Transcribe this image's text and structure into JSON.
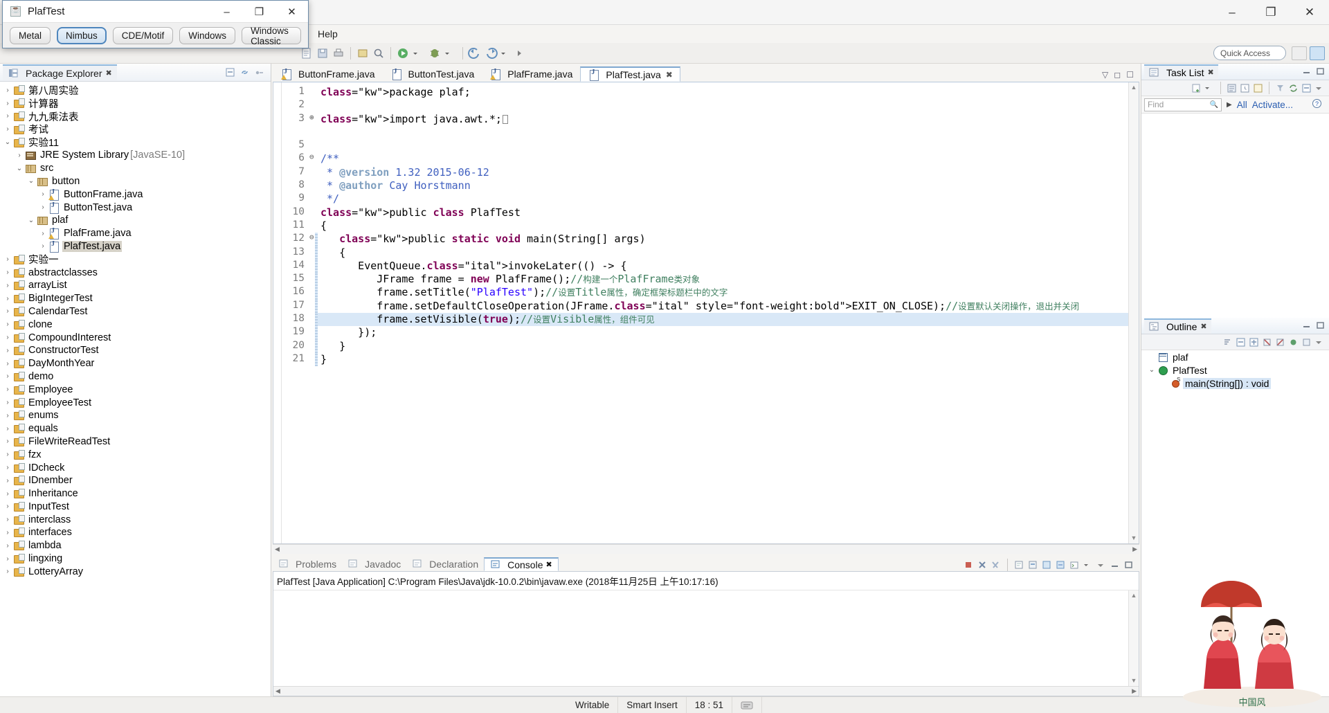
{
  "window": {
    "menu_visible_label": "Help",
    "minimize": "–",
    "maximize": "❐",
    "close": "✕"
  },
  "toolbar": {
    "quick_access_placeholder": "Quick Access"
  },
  "package_explorer": {
    "title": "Package Explorer",
    "close_glyph": "✖",
    "items": [
      {
        "label": "第八周实验",
        "indent": 0,
        "arrow": "›",
        "icon": "project-icon"
      },
      {
        "label": "计算器",
        "indent": 0,
        "arrow": "›",
        "icon": "project-icon"
      },
      {
        "label": "九九乘法表",
        "indent": 0,
        "arrow": "›",
        "icon": "project-icon"
      },
      {
        "label": "考试",
        "indent": 0,
        "arrow": "›",
        "icon": "project-icon"
      },
      {
        "label": "实验11",
        "indent": 0,
        "arrow": "⌄",
        "icon": "project-icon"
      },
      {
        "label": "JRE System Library",
        "suffix": " [JavaSE-10]",
        "indent": 1,
        "arrow": "›",
        "icon": "library-icon"
      },
      {
        "label": "src",
        "indent": 1,
        "arrow": "⌄",
        "icon": "source-folder-icon"
      },
      {
        "label": "button",
        "indent": 2,
        "arrow": "⌄",
        "icon": "package-icon"
      },
      {
        "label": "ButtonFrame.java",
        "indent": 3,
        "arrow": "›",
        "icon": "java-warning-icon"
      },
      {
        "label": "ButtonTest.java",
        "indent": 3,
        "arrow": "›",
        "icon": "java-file-icon"
      },
      {
        "label": "plaf",
        "indent": 2,
        "arrow": "⌄",
        "icon": "package-icon"
      },
      {
        "label": "PlafFrame.java",
        "indent": 3,
        "arrow": "›",
        "icon": "java-warning-icon"
      },
      {
        "label": "PlafTest.java",
        "indent": 3,
        "arrow": "›",
        "icon": "java-file-icon",
        "selected": true
      },
      {
        "label": "实验一",
        "indent": 0,
        "arrow": "›",
        "icon": "project-icon"
      },
      {
        "label": "abstractclasses",
        "indent": 0,
        "arrow": "›",
        "icon": "project-icon"
      },
      {
        "label": "arrayList",
        "indent": 0,
        "arrow": "›",
        "icon": "project-icon"
      },
      {
        "label": "BigIntegerTest",
        "indent": 0,
        "arrow": "›",
        "icon": "project-icon"
      },
      {
        "label": "CalendarTest",
        "indent": 0,
        "arrow": "›",
        "icon": "project-icon"
      },
      {
        "label": "clone",
        "indent": 0,
        "arrow": "›",
        "icon": "project-icon"
      },
      {
        "label": "CompoundInterest",
        "indent": 0,
        "arrow": "›",
        "icon": "project-icon"
      },
      {
        "label": "ConstructorTest",
        "indent": 0,
        "arrow": "›",
        "icon": "project-icon"
      },
      {
        "label": "DayMonthYear",
        "indent": 0,
        "arrow": "›",
        "icon": "project-icon"
      },
      {
        "label": "demo",
        "indent": 0,
        "arrow": "›",
        "icon": "project-icon"
      },
      {
        "label": "Employee",
        "indent": 0,
        "arrow": "›",
        "icon": "project-icon"
      },
      {
        "label": "EmployeeTest",
        "indent": 0,
        "arrow": "›",
        "icon": "project-icon"
      },
      {
        "label": "enums",
        "indent": 0,
        "arrow": "›",
        "icon": "project-icon"
      },
      {
        "label": "equals",
        "indent": 0,
        "arrow": "›",
        "icon": "project-icon"
      },
      {
        "label": "FileWriteReadTest",
        "indent": 0,
        "arrow": "›",
        "icon": "project-icon"
      },
      {
        "label": "fzx",
        "indent": 0,
        "arrow": "›",
        "icon": "project-icon"
      },
      {
        "label": "IDcheck",
        "indent": 0,
        "arrow": "›",
        "icon": "project-icon"
      },
      {
        "label": "IDnember",
        "indent": 0,
        "arrow": "›",
        "icon": "project-icon"
      },
      {
        "label": "Inheritance",
        "indent": 0,
        "arrow": "›",
        "icon": "project-icon"
      },
      {
        "label": "InputTest",
        "indent": 0,
        "arrow": "›",
        "icon": "project-icon"
      },
      {
        "label": "interclass",
        "indent": 0,
        "arrow": "›",
        "icon": "project-icon"
      },
      {
        "label": "interfaces",
        "indent": 0,
        "arrow": "›",
        "icon": "project-icon"
      },
      {
        "label": "lambda",
        "indent": 0,
        "arrow": "›",
        "icon": "project-icon"
      },
      {
        "label": "lingxing",
        "indent": 0,
        "arrow": "›",
        "icon": "project-icon"
      },
      {
        "label": "LotteryArray",
        "indent": 0,
        "arrow": "›",
        "icon": "project-icon"
      }
    ]
  },
  "editor": {
    "tabs": [
      {
        "label": "ButtonFrame.java",
        "active": false,
        "icon": "java-warning-icon"
      },
      {
        "label": "ButtonTest.java",
        "active": false,
        "icon": "java-file-icon"
      },
      {
        "label": "PlafFrame.java",
        "active": false,
        "icon": "java-warning-icon"
      },
      {
        "label": "PlafTest.java",
        "active": true,
        "icon": "java-file-icon",
        "close_glyph": "✖"
      }
    ],
    "line_numbers": [
      "1",
      "2",
      "3",
      "",
      "5",
      "6",
      "7",
      "8",
      "9",
      "10",
      "11",
      "12",
      "13",
      "14",
      "15",
      "16",
      "17",
      "18",
      "19",
      "20",
      "21"
    ],
    "fold_markers": [
      "",
      "",
      "⊕",
      "",
      "",
      "⊖",
      "",
      "",
      "",
      "",
      "",
      "⊖",
      "",
      "",
      "",
      "",
      "",
      "",
      "",
      "",
      ""
    ],
    "code_lines": [
      "package plaf;",
      "",
      "import java.awt.*;",
      "",
      "",
      "/**",
      " * @version 1.32 2015-06-12",
      " * @author Cay Horstmann",
      " */",
      "public class PlafTest",
      "{",
      "   public static void main(String[] args)",
      "   {",
      "      EventQueue.invokeLater(() -> {",
      "         JFrame frame = new PlafFrame();//构建一个PlafFrame类对象",
      "         frame.setTitle(\"PlafTest\");//设置Title属性，确定框架标题栏中的文字",
      "         frame.setDefaultCloseOperation(JFrame.EXIT_ON_CLOSE);//设置默认关闭操作，退出并关闭",
      "         frame.setVisible(true);//设置Visible属性，组件可见",
      "      });",
      "   }",
      "}"
    ],
    "highlighted_line_index": 17
  },
  "console": {
    "tabs": [
      {
        "label": "Problems",
        "active": false,
        "icon": "problems-icon"
      },
      {
        "label": "Javadoc",
        "active": false,
        "icon": "javadoc-icon"
      },
      {
        "label": "Declaration",
        "active": false,
        "icon": "declaration-icon"
      },
      {
        "label": "Console",
        "active": true,
        "icon": "console-icon",
        "close_glyph": "✖"
      }
    ],
    "launch_line": "PlafTest [Java Application] C:\\Program Files\\Java\\jdk-10.0.2\\bin\\javaw.exe (2018年11月25日 上午10:17:16)"
  },
  "task_list": {
    "title": "Task List",
    "close_glyph": "✖",
    "find_placeholder": "Find",
    "all_label": "All",
    "activate_label": "Activate..."
  },
  "outline": {
    "title": "Outline",
    "close_glyph": "✖",
    "items": [
      {
        "label": "plaf",
        "icon": "package-declaration-icon",
        "indent": 0,
        "arrow": ""
      },
      {
        "label": "PlafTest",
        "icon": "class-icon",
        "indent": 0,
        "arrow": "⌄"
      },
      {
        "label": "main(String[]) : void",
        "icon": "method-static-icon",
        "indent": 1,
        "arrow": "",
        "selected": true
      }
    ]
  },
  "status_bar": {
    "writable": "Writable",
    "insert_mode": "Smart Insert",
    "cursor_position": "18 : 51"
  },
  "plaf_window": {
    "title": "PlafTest",
    "minimize": "–",
    "maximize": "❐",
    "close": "✕",
    "buttons": [
      {
        "label": "Metal",
        "active": false
      },
      {
        "label": "Nimbus",
        "active": true
      },
      {
        "label": "CDE/Motif",
        "active": false
      },
      {
        "label": "Windows",
        "active": false
      },
      {
        "label": "Windows Classic",
        "active": false
      }
    ]
  },
  "colors": {
    "accent": "#7fa8d0",
    "keyword": "#7f0055",
    "string": "#2a00ff",
    "comment": "#3f7f5f",
    "javadoc": "#3f5fbf",
    "selection": "#d9e8f7"
  }
}
